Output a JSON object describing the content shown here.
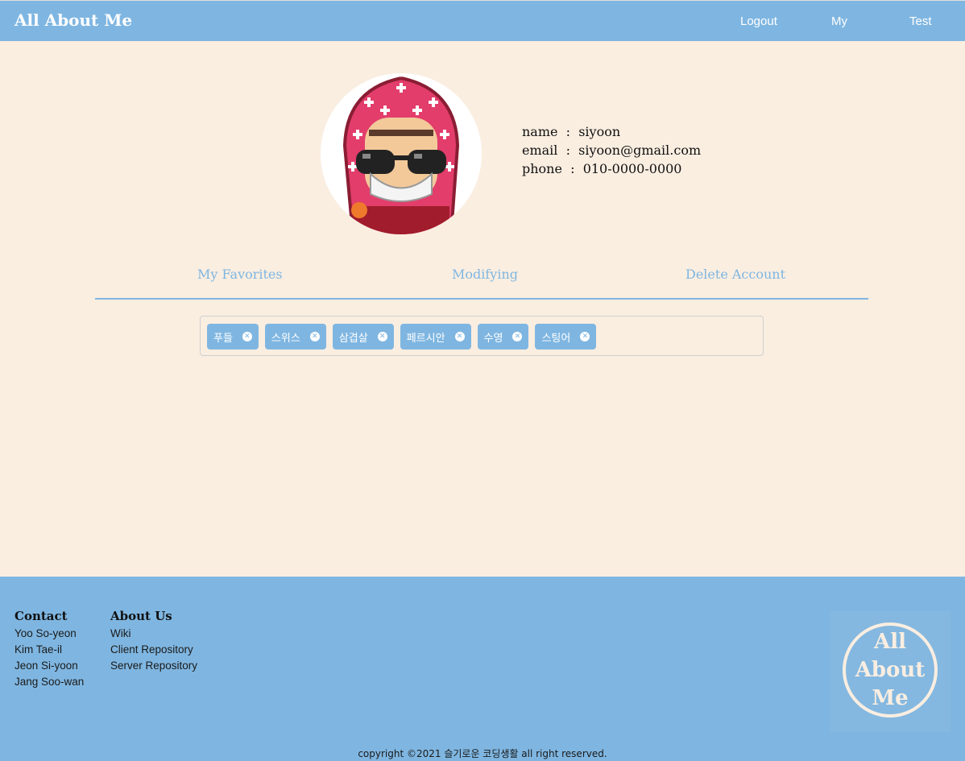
{
  "header": {
    "brand": "All About Me",
    "links": {
      "logout": "Logout",
      "my": "My",
      "test": "Test"
    }
  },
  "profile": {
    "avatar_icon": "pixel-character-avatar",
    "name_label": "name",
    "name_value": "siyoon",
    "email_label": "email",
    "email_value": "siyoon@gmail.com",
    "phone_label": "phone",
    "phone_value": "010-0000-0000",
    "separator": ":"
  },
  "tabs": {
    "favorites": "My Favorites",
    "modifying": "Modifying",
    "delete": "Delete Account"
  },
  "chips": [
    "푸들",
    "스위스",
    "삼겹살",
    "페르시안",
    "수영",
    "스팅어"
  ],
  "footer": {
    "contact": {
      "heading": "Contact",
      "items": [
        "Yoo So-yeon",
        "Kim Tae-il",
        "Jeon Si-yoon",
        "Jang Soo-wan"
      ]
    },
    "about": {
      "heading": "About Us",
      "items": [
        "Wiki",
        "Client Repository",
        "Server Repository"
      ]
    },
    "logo": {
      "line1": "All",
      "line2": "About",
      "line3": "Me"
    },
    "copyright": "copyright ©2021 슬기로운 코딩생활 all right reserved."
  },
  "colors": {
    "accent": "#7fb6e1",
    "background": "#faeee1"
  }
}
